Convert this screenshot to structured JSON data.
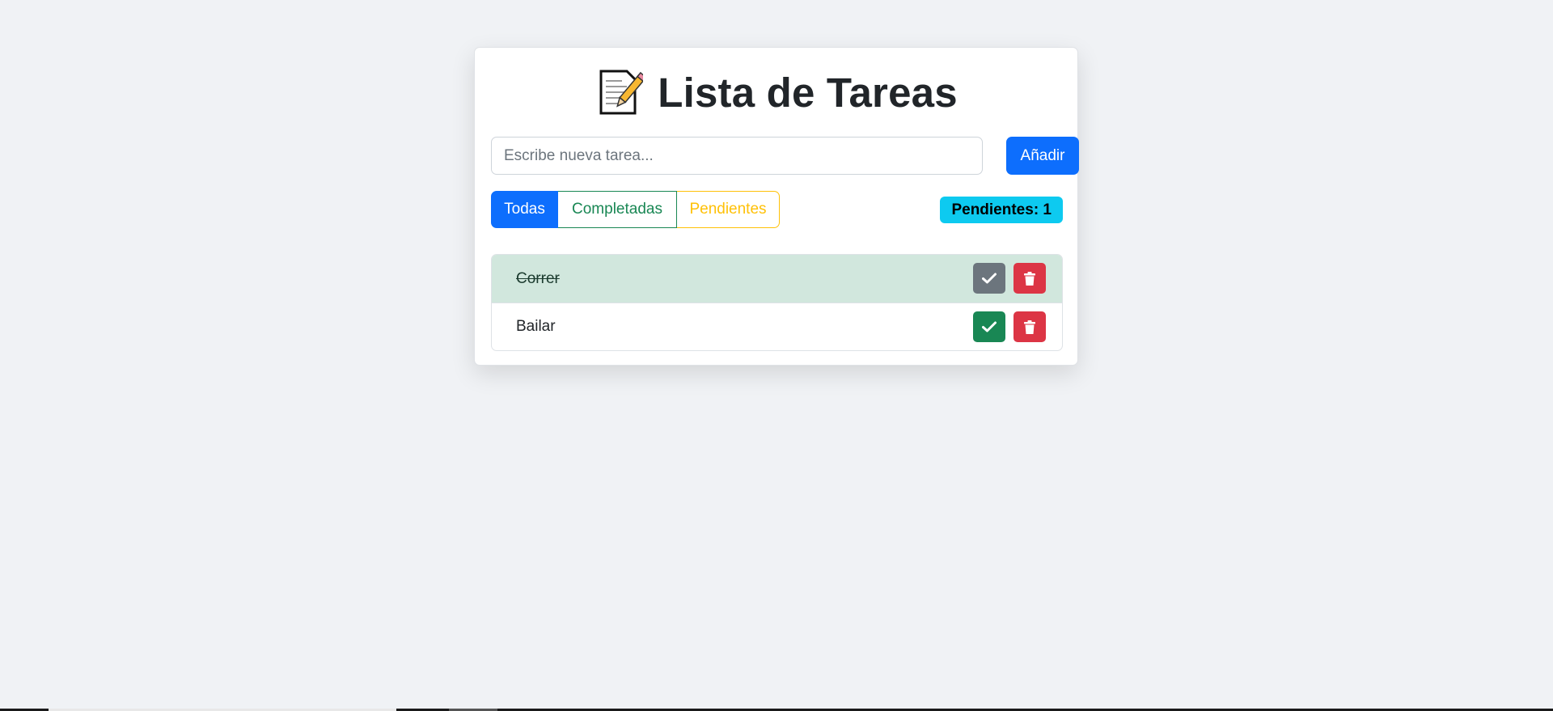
{
  "app": {
    "title": "Lista de Tareas",
    "title_icon": "memo-pencil-icon"
  },
  "new_task": {
    "placeholder": "Escribe nueva tarea...",
    "value": "",
    "add_label": "Añadir"
  },
  "filters": {
    "all_label": "Todas",
    "completed_label": "Completadas",
    "pending_label": "Pendientes",
    "active": "Todas"
  },
  "pending_badge": "Pendientes: 1",
  "tasks": [
    {
      "label": "Correr",
      "completed": true
    },
    {
      "label": "Bailar",
      "completed": false
    }
  ],
  "icons": {
    "toggle": "check-icon",
    "delete": "trash-icon"
  },
  "colors": {
    "primary": "#0d6efd",
    "success": "#198754",
    "warning": "#ffc107",
    "info": "#0dcaf0",
    "danger": "#dc3545",
    "secondary": "#6c757d",
    "completed_row": "#d1e7dd",
    "background": "#f0f2f5"
  }
}
